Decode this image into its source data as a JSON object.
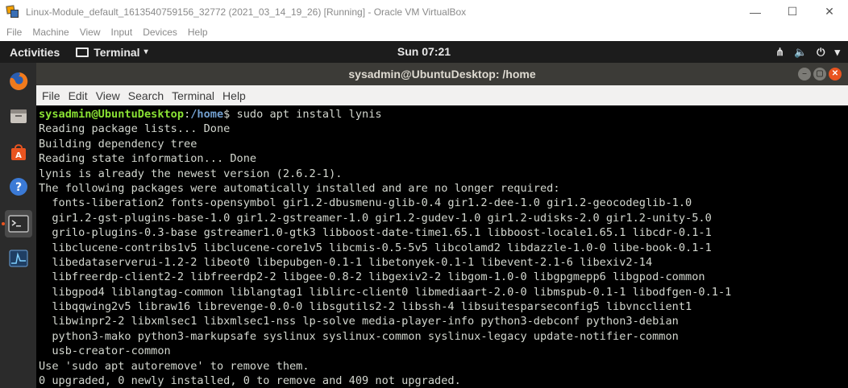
{
  "host_window": {
    "title": "Linux-Module_default_1613540759156_32772 (2021_03_14_19_26) [Running] - Oracle VM VirtualBox",
    "controls": {
      "minimize": "—",
      "maximize": "☐",
      "close": "✕"
    },
    "menu": [
      "File",
      "Machine",
      "View",
      "Input",
      "Devices",
      "Help"
    ]
  },
  "gnome_bar": {
    "activities": "Activities",
    "app_label": "Terminal",
    "caret": "▾",
    "clock": "Sun 07:21",
    "tray": {
      "network": "⋔",
      "volume": "🔈",
      "power": "⏻",
      "menu": "▾"
    }
  },
  "dock": {
    "items": [
      {
        "name": "firefox-icon",
        "active": false
      },
      {
        "name": "files-icon",
        "active": false
      },
      {
        "name": "software-center-icon",
        "active": false
      },
      {
        "name": "help-icon",
        "active": false
      },
      {
        "name": "terminal-icon",
        "active": true
      },
      {
        "name": "system-monitor-icon",
        "active": false
      }
    ]
  },
  "terminal": {
    "title": "sysadmin@UbuntuDesktop: /home",
    "window_buttons": {
      "minimize": "–",
      "maximize": "▢",
      "close": "✕"
    },
    "menu": [
      "File",
      "Edit",
      "View",
      "Search",
      "Terminal",
      "Help"
    ],
    "prompt": {
      "user_host": "sysadmin@UbuntuDesktop",
      "sep": ":",
      "path": "/home",
      "symbol": "$",
      "command": " sudo apt install lynis"
    },
    "output_lines": [
      "Reading package lists... Done",
      "Building dependency tree",
      "Reading state information... Done",
      "lynis is already the newest version (2.6.2-1).",
      "The following packages were automatically installed and are no longer required:",
      "  fonts-liberation2 fonts-opensymbol gir1.2-dbusmenu-glib-0.4 gir1.2-dee-1.0 gir1.2-geocodeglib-1.0",
      "  gir1.2-gst-plugins-base-1.0 gir1.2-gstreamer-1.0 gir1.2-gudev-1.0 gir1.2-udisks-2.0 gir1.2-unity-5.0",
      "  grilo-plugins-0.3-base gstreamer1.0-gtk3 libboost-date-time1.65.1 libboost-locale1.65.1 libcdr-0.1-1",
      "  libclucene-contribs1v5 libclucene-core1v5 libcmis-0.5-5v5 libcolamd2 libdazzle-1.0-0 libe-book-0.1-1",
      "  libedataserverui-1.2-2 libeot0 libepubgen-0.1-1 libetonyek-0.1-1 libevent-2.1-6 libexiv2-14",
      "  libfreerdp-client2-2 libfreerdp2-2 libgee-0.8-2 libgexiv2-2 libgom-1.0-0 libgpgmepp6 libgpod-common",
      "  libgpod4 liblangtag-common liblangtag1 liblirc-client0 libmediaart-2.0-0 libmspub-0.1-1 libodfgen-0.1-1",
      "  libqqwing2v5 libraw16 librevenge-0.0-0 libsgutils2-2 libssh-4 libsuitesparseconfig5 libvncclient1",
      "  libwinpr2-2 libxmlsec1 libxmlsec1-nss lp-solve media-player-info python3-debconf python3-debian",
      "  python3-mako python3-markupsafe syslinux syslinux-common syslinux-legacy update-notifier-common",
      "  usb-creator-common",
      "Use 'sudo apt autoremove' to remove them.",
      "0 upgraded, 0 newly installed, 0 to remove and 409 not upgraded."
    ]
  }
}
